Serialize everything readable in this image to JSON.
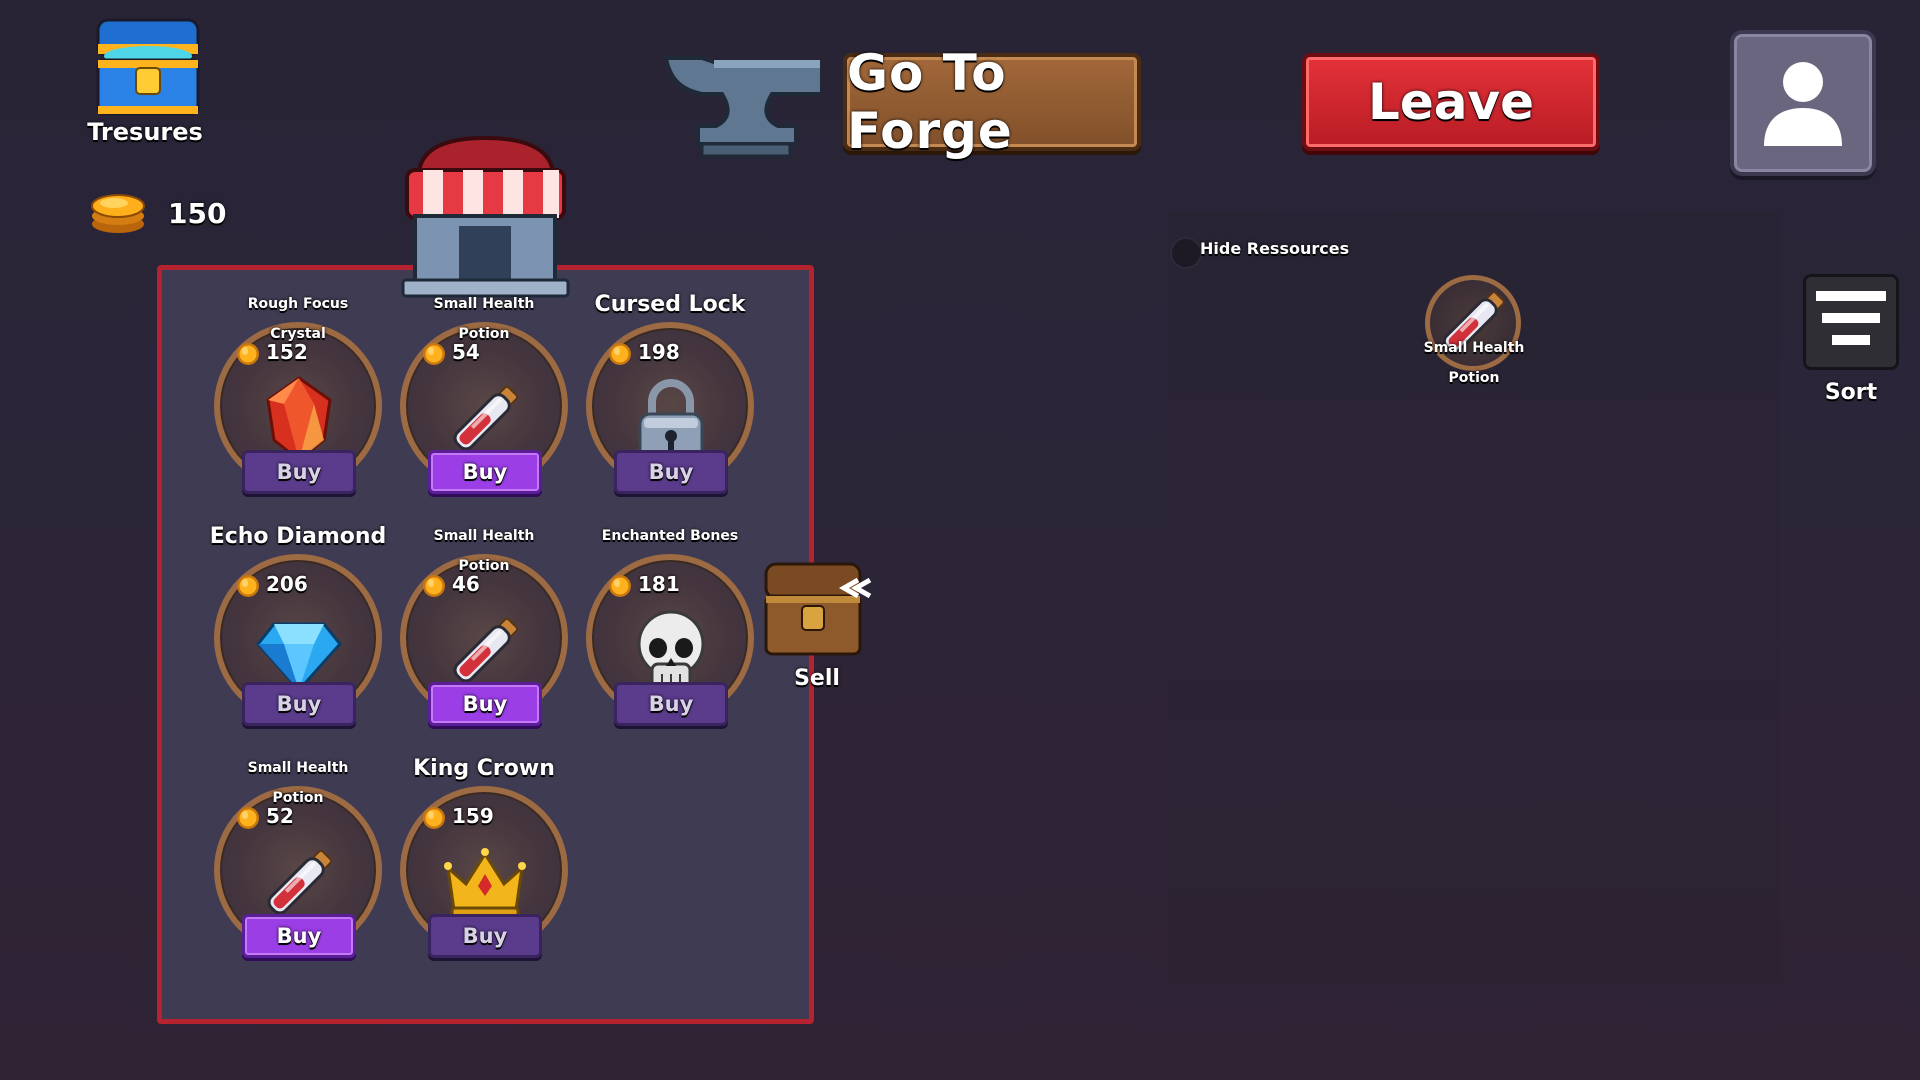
{
  "header": {
    "treasures_label": "Tresures",
    "coins": "150",
    "forge_button": "Go To Forge",
    "leave_button": "Leave"
  },
  "inventory": {
    "hide_resources_label": "Hide Ressources",
    "item_line1": "Small Health",
    "item_line2": "Potion",
    "sort_label": "Sort"
  },
  "shop": {
    "buy_label": "Buy",
    "sell_label": "Sell",
    "items": [
      {
        "title": "Rough Focus",
        "sub": "Crystal",
        "price": "152",
        "icon": "red-crystal-icon",
        "enabled": false,
        "big": false
      },
      {
        "title": "Small Health",
        "sub": "Potion",
        "price": "54",
        "icon": "health-potion-icon",
        "enabled": true,
        "big": false
      },
      {
        "title": "Cursed Lock",
        "sub": "",
        "price": "198",
        "icon": "padlock-icon",
        "enabled": false,
        "big": true
      },
      {
        "title": "Echo Diamond",
        "sub": "",
        "price": "206",
        "icon": "diamond-icon",
        "enabled": false,
        "big": true
      },
      {
        "title": "Small Health",
        "sub": "Potion",
        "price": "46",
        "icon": "health-potion-icon",
        "enabled": true,
        "big": false
      },
      {
        "title": "Enchanted Bones",
        "sub": "",
        "price": "181",
        "icon": "skull-icon",
        "enabled": false,
        "big": false
      },
      {
        "title": "Small Health",
        "sub": "Potion",
        "price": "52",
        "icon": "health-potion-icon",
        "enabled": true,
        "big": false
      },
      {
        "title": "King Crown",
        "sub": "",
        "price": "159",
        "icon": "crown-icon",
        "enabled": false,
        "big": true
      }
    ]
  },
  "colors": {
    "background": "#2a2537",
    "shop_border": "#b52330",
    "buy_active": "#9b3ee6",
    "leave_red": "#d92830",
    "forge_brown": "#93603a"
  }
}
